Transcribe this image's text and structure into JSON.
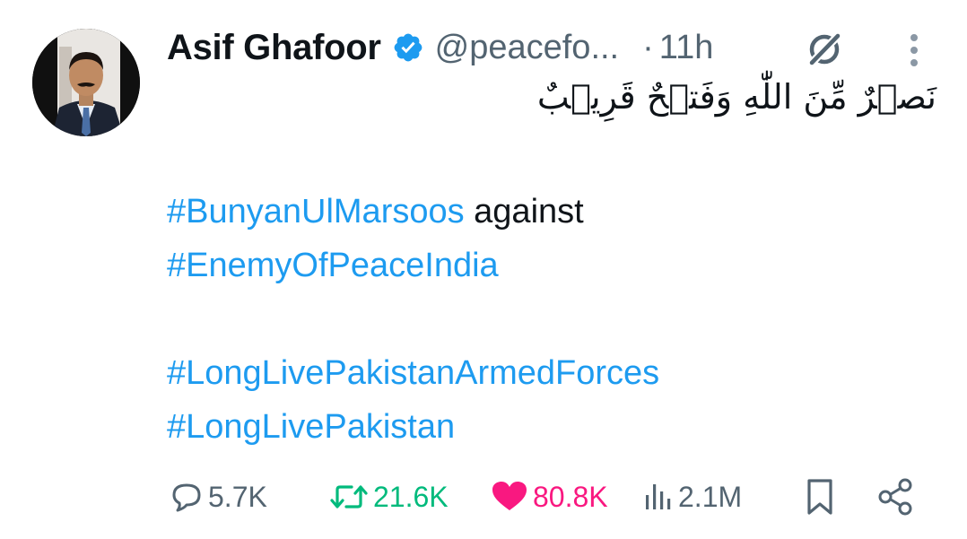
{
  "author": {
    "name": "Asif Ghafoor",
    "handle": "@peacefo...",
    "separator": "·",
    "time": "11h"
  },
  "tweet": {
    "arabic_line": "نَصۡرٌ مِّنَ اللّٰهِ وَفَتۡحٌ قَرِيۡبٌ",
    "line1_tag": "#BunyanUlMarsoos",
    "line1_text": " against",
    "line2_tag": "#EnemyOfPeaceIndia",
    "line3_tag": "#LongLivePakistanArmedForces",
    "line4_tag": "#LongLivePakistan"
  },
  "actions": {
    "replies": "5.7K",
    "reposts": "21.6K",
    "likes": "80.8K",
    "views": "2.1M"
  },
  "icons": {
    "verified": "verified-badge-icon",
    "grok": "grok-icon",
    "more": "more-vertical-icon",
    "reply": "reply-bubble-icon",
    "repost": "repost-icon",
    "like": "heart-icon",
    "views": "views-bars-icon",
    "bookmark": "bookmark-icon",
    "share": "share-icon"
  },
  "colors": {
    "accent": "#1d9bf0",
    "text": "#0f1419",
    "muted": "#536471",
    "repost_active": "#00ba7c",
    "like_active": "#f91880"
  }
}
